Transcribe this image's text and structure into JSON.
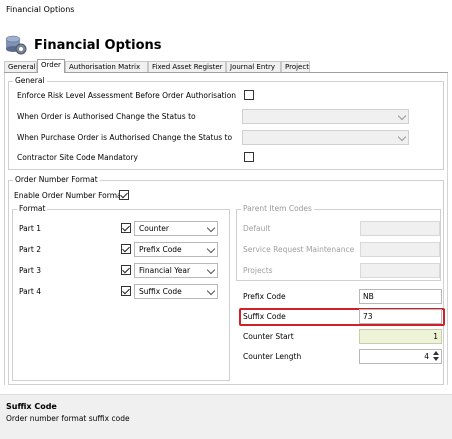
{
  "window": {
    "title": "Financial Options"
  },
  "header": {
    "title": "Financial Options",
    "icon": "settings-gears-icon"
  },
  "tabs": [
    {
      "label": "General",
      "active": false
    },
    {
      "label": "Order",
      "active": true
    },
    {
      "label": "Authorisation Matrix",
      "active": false
    },
    {
      "label": "Fixed Asset Register",
      "active": false
    },
    {
      "label": "Journal Entry",
      "active": false
    },
    {
      "label": "Project",
      "active": false
    }
  ],
  "general": {
    "legend": "General",
    "enforce_risk_label": "Enforce Risk Level Assessment Before Order Authorisation",
    "order_authorised_label": "When Order is Authorised Change the Status to",
    "po_authorised_label": "When Purchase Order is Authorised Change the Status to",
    "contractor_site_label": "Contractor Site Code Mandatory",
    "enforce_risk_checked": false,
    "contractor_site_checked": false,
    "order_authorised_value": "",
    "po_authorised_value": ""
  },
  "order_number_format": {
    "legend": "Order Number Format",
    "enable_label": "Enable Order Number Format",
    "enable_checked": true,
    "format": {
      "legend": "Format",
      "parts": [
        {
          "label": "Part 1",
          "checked": true,
          "value": "Counter"
        },
        {
          "label": "Part 2",
          "checked": true,
          "value": "Prefix Code"
        },
        {
          "label": "Part 3",
          "checked": true,
          "value": "Financial Year"
        },
        {
          "label": "Part 4",
          "checked": true,
          "value": "Suffix Code"
        }
      ]
    },
    "parent_item_codes": {
      "legend": "Parent Item Codes",
      "default_label": "Default",
      "service_request_label": "Service Request Maintenance",
      "projects_label": "Projects",
      "default_value": "",
      "service_request_value": "",
      "projects_value": ""
    },
    "prefix_code_label": "Prefix Code",
    "prefix_code_value": "NB",
    "suffix_code_label": "Suffix Code",
    "suffix_code_value": "73",
    "counter_start_label": "Counter Start",
    "counter_start_value": "1",
    "counter_length_label": "Counter Length",
    "counter_length_value": "4"
  },
  "description": {
    "title": "Suffix Code",
    "text": "Order number format suffix code"
  },
  "colors": {
    "highlight": "#d0202a",
    "readonly_bg": "#eef3d8"
  }
}
